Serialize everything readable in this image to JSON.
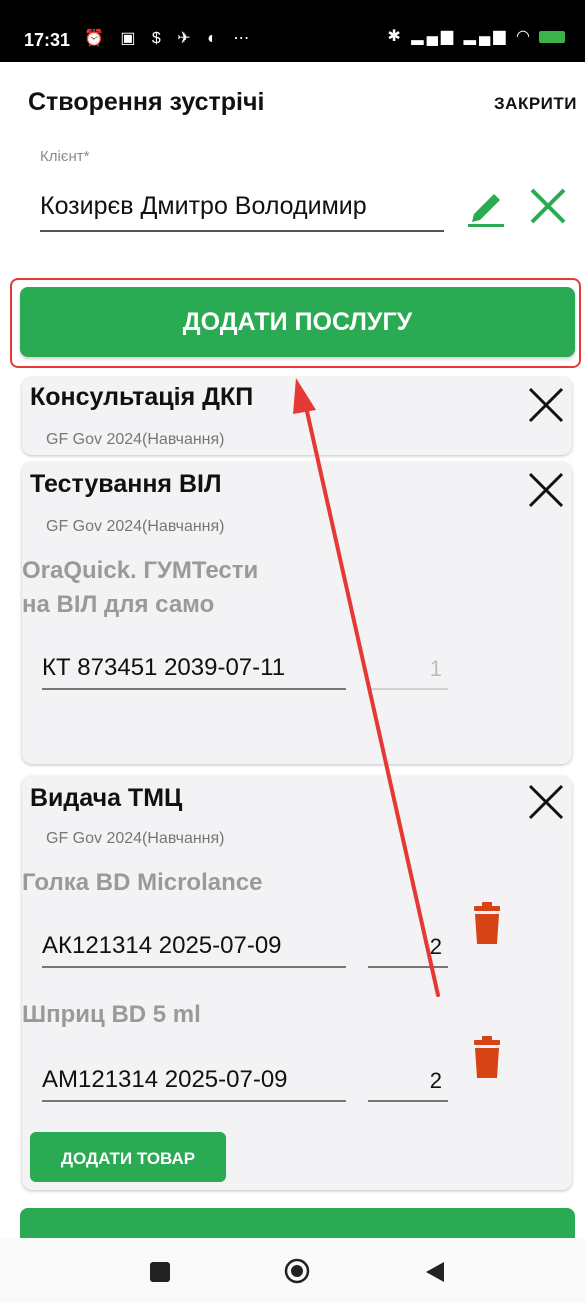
{
  "status_bar": {
    "time": "17:31",
    "left_icons": "⏰ ▣ $ ✈ ◐ ⋯",
    "right_icons": "✱ ▂▄▆ ▂▄▆ ◠"
  },
  "header": {
    "title": "Створення зустрічі",
    "close_label": "ЗАКРИТИ"
  },
  "client": {
    "label": "Клієнт*",
    "value": "Козирєв Дмитро Володимир"
  },
  "add_service_label": "ДОДАТИ ПОСЛУГУ",
  "services": [
    {
      "title": "Консультація ДКП",
      "subtitle": "GF Gov 2024(Навчання)"
    },
    {
      "title": "Тестування ВІЛ",
      "subtitle": "GF Gov 2024(Навчання)",
      "items": [
        {
          "name_line1": "OraQuick. ГУМТести",
          "name_line2": "на ВІЛ для само",
          "batch": "КТ 873451 2039-07-11",
          "qty": "1"
        }
      ]
    },
    {
      "title": "Видача ТМЦ",
      "subtitle": "GF Gov 2024(Навчання)",
      "items": [
        {
          "name": "Голка BD Microlance",
          "batch": "АК121314 2025-07-09",
          "qty": "2"
        },
        {
          "name": "Шприц BD 5 ml",
          "batch": "АМ121314 2025-07-09",
          "qty": "2"
        }
      ],
      "add_goods_label": "ДОДАТИ ТОВАР"
    }
  ],
  "colors": {
    "accent": "#2aaa52",
    "highlight": "#e53935",
    "trash": "#d84315"
  },
  "icons": [
    "edit-icon",
    "close-icon",
    "trash-icon",
    "nav-recents-icon",
    "nav-home-icon",
    "nav-back-icon"
  ]
}
